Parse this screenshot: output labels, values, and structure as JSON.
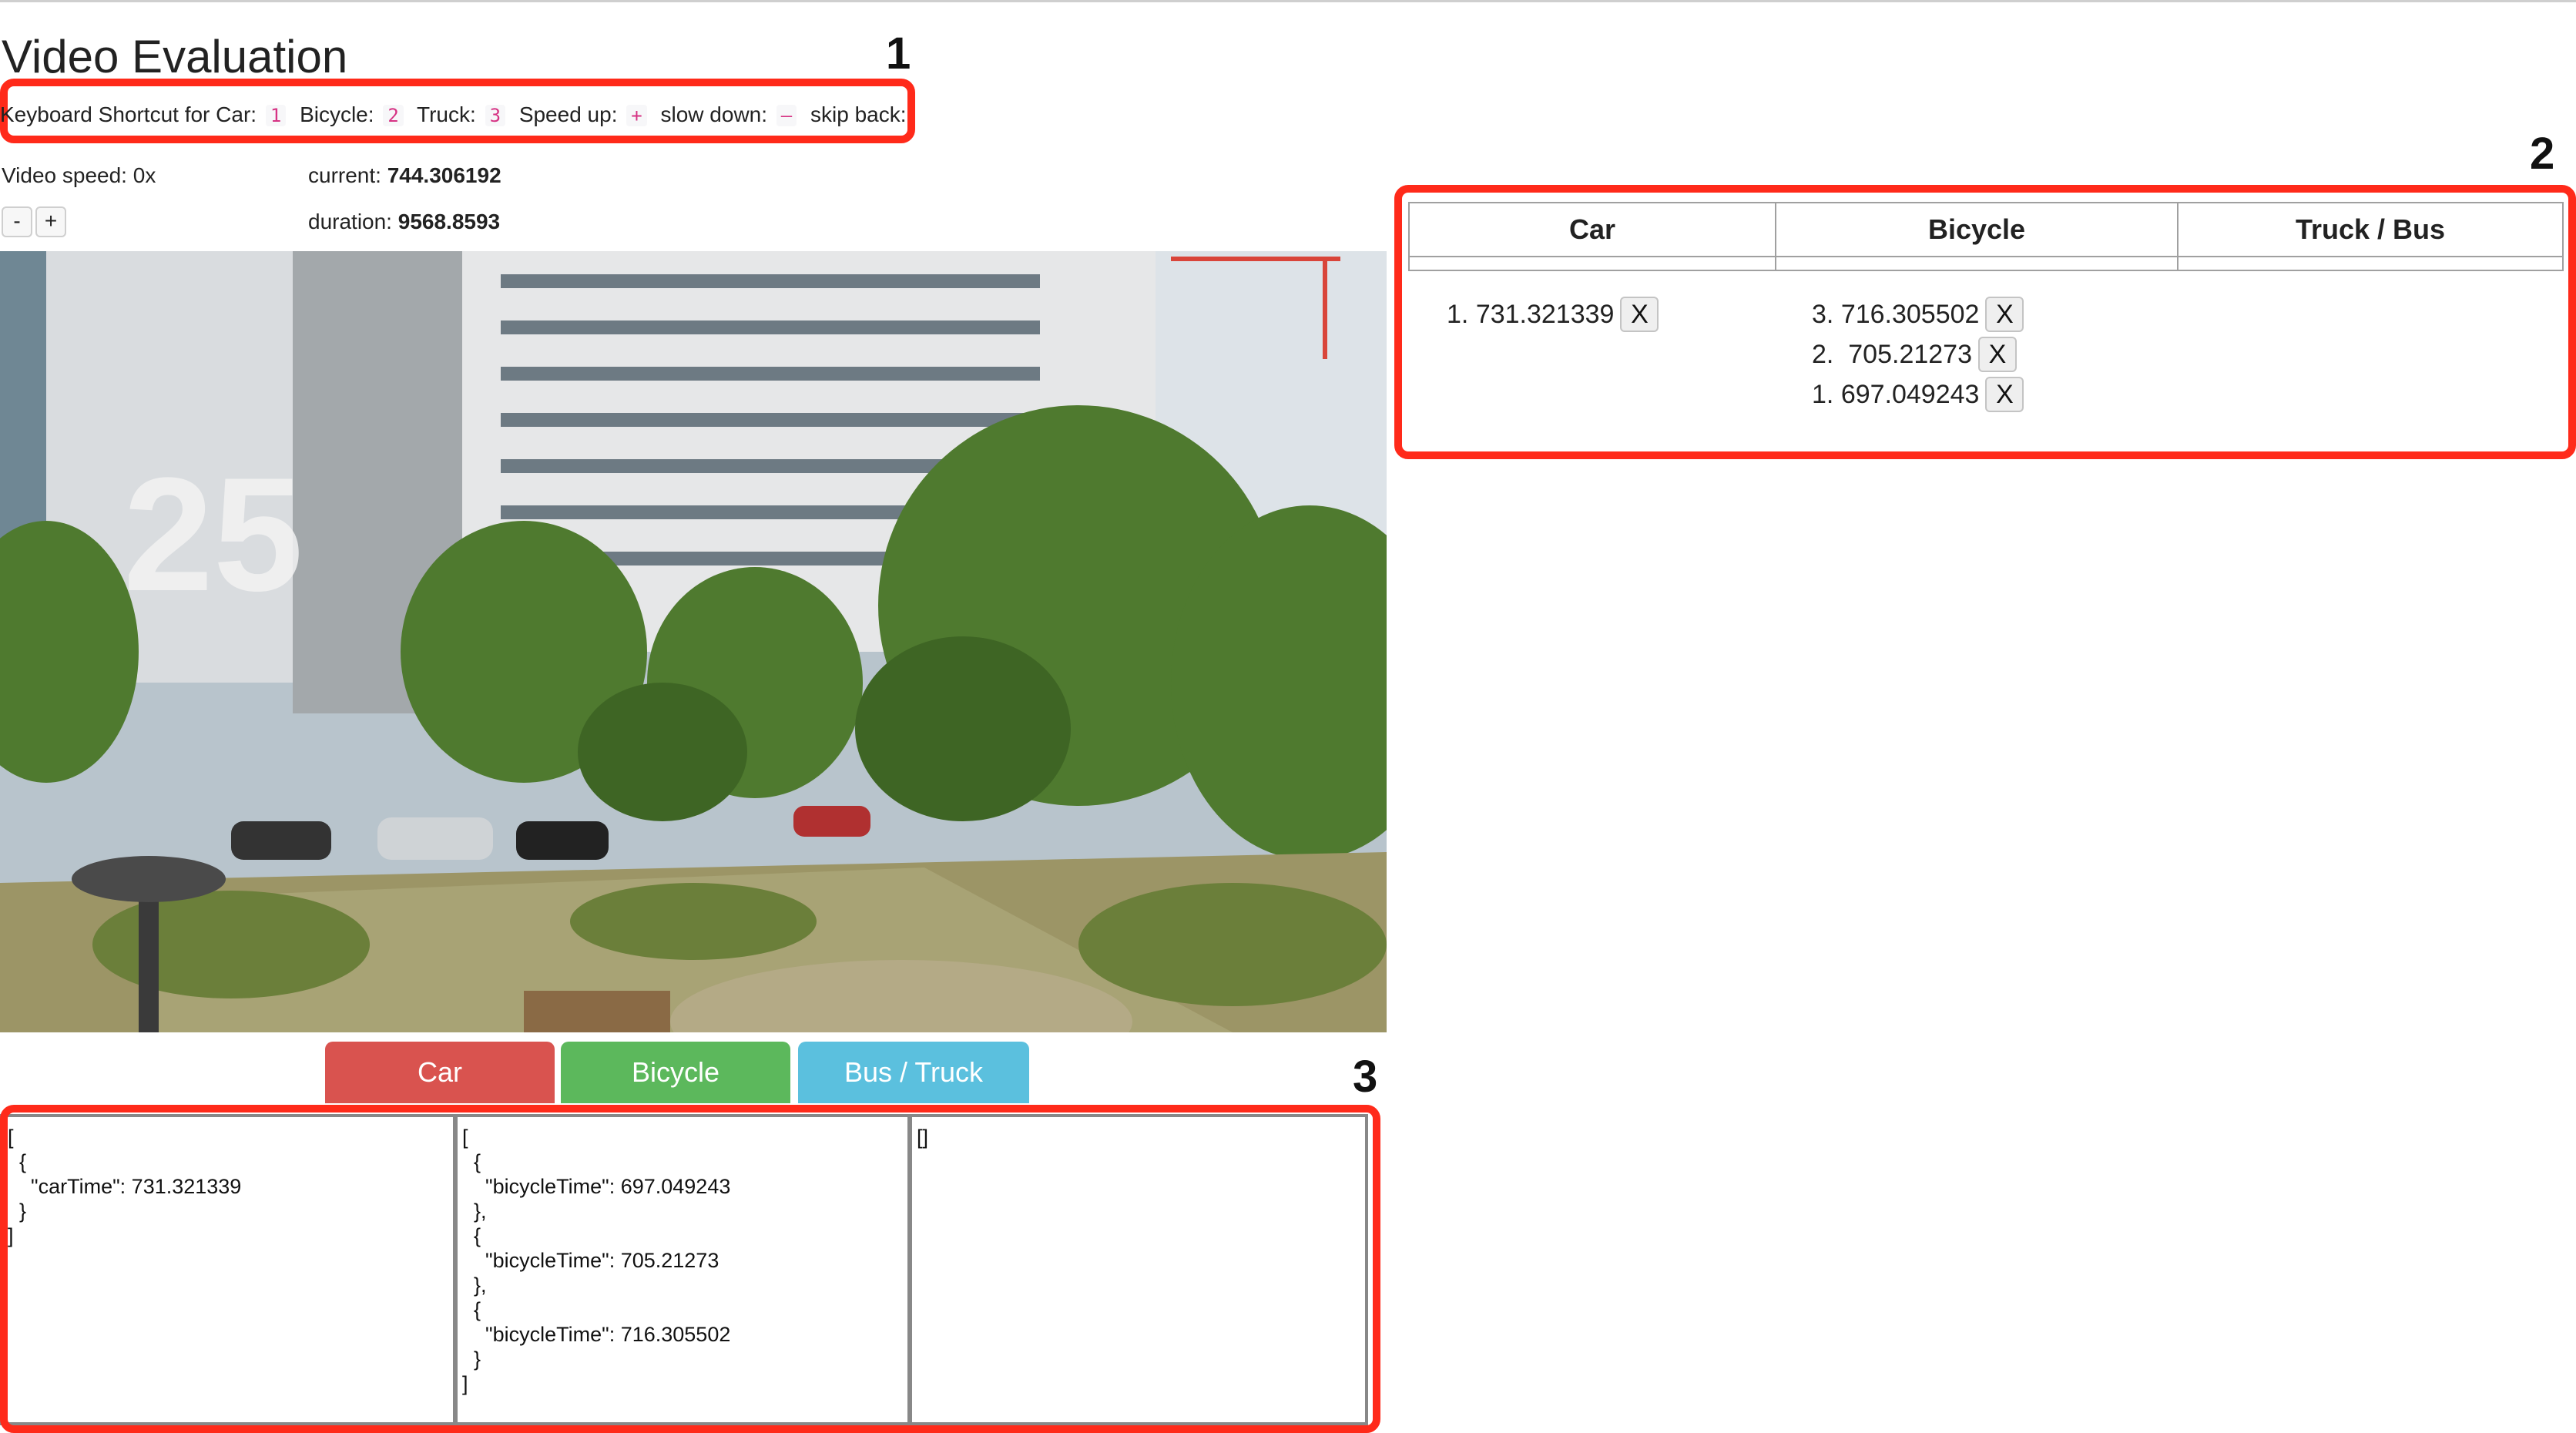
{
  "page_title": "Video Evaluation",
  "callouts": [
    "1",
    "2",
    "3"
  ],
  "shortcuts": {
    "prefix": "Keyboard Shortcut for Car:",
    "car_key": "1",
    "bicycle_label": "Bicycle:",
    "bicycle_key": "2",
    "truck_label": "Truck:",
    "truck_key": "3",
    "speedup_label": "Speed up:",
    "speedup_key": "+",
    "slowdown_label": "slow down:",
    "slowdown_key": "–",
    "skipback_label": "skip back:",
    "skipback_key": "#"
  },
  "video": {
    "speed_label": "Video speed:",
    "speed_value": "0x",
    "current_label": "current:",
    "current_value": "744.306192",
    "duration_label": "duration:",
    "duration_value": "9568.8593",
    "minus_label": "-",
    "plus_label": "+"
  },
  "category_buttons": [
    {
      "label": "Car",
      "color": "#d9534f"
    },
    {
      "label": "Bicycle",
      "color": "#5cb85c"
    },
    {
      "label": "Bus / Truck",
      "color": "#5bc0de"
    }
  ],
  "json_panels": [
    "[\n  {\n    \"carTime\": 731.321339\n  }\n]",
    "[\n  {\n    \"bicycleTime\": 697.049243\n  },\n  {\n    \"bicycleTime\": 705.21273\n  },\n  {\n    \"bicycleTime\": 716.305502\n  }\n]",
    "[]"
  ],
  "table": {
    "headers": [
      "Car",
      "Bicycle",
      "Truck / Bus"
    ],
    "car_entries": [
      {
        "index": "1.",
        "value": "731.321339"
      }
    ],
    "bicycle_entries": [
      {
        "index": "3.",
        "value": "716.305502"
      },
      {
        "index": "2.",
        "value": "705.21273"
      },
      {
        "index": "1.",
        "value": "697.049243"
      }
    ],
    "remove_label": "X"
  }
}
